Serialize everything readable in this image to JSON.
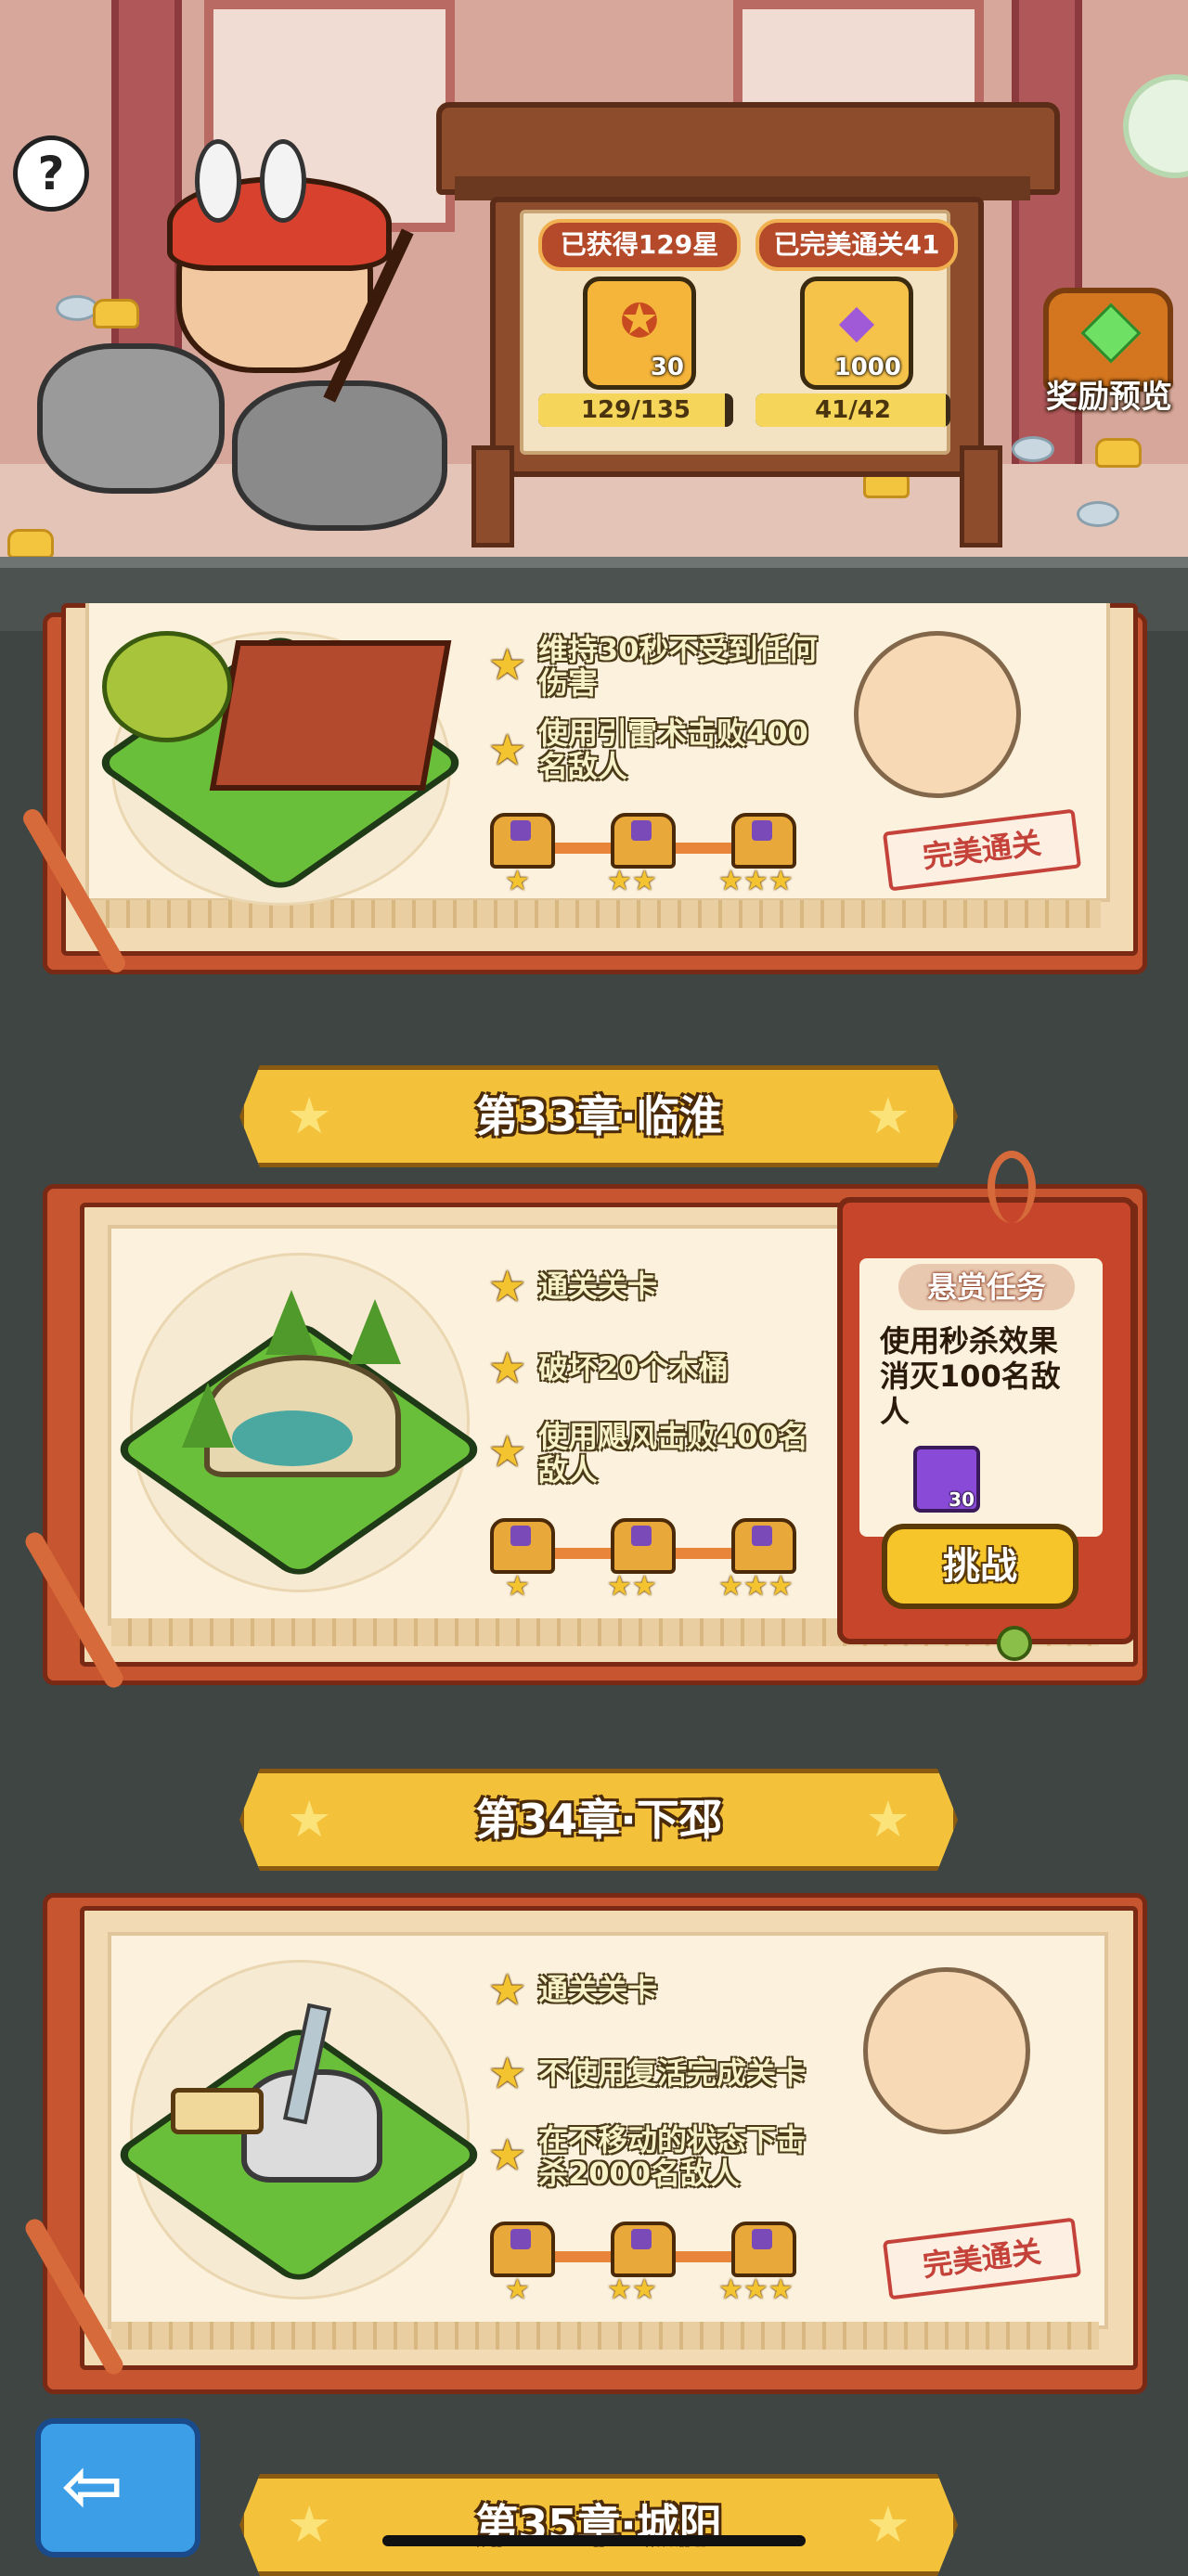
{
  "header": {
    "help_icon": "question-mark-icon",
    "stars_label": "已获得129星",
    "perfect_label": "已完美通关41",
    "stars_reward_count": "30",
    "perfect_reward_count": "1000",
    "stars_progress": "129/135",
    "stars_progress_fraction": 0.956,
    "perfect_progress": "41/42",
    "perfect_progress_fraction": 0.976,
    "reward_preview_label": "奖励预览",
    "reward_preview_icon": "treasure-chest-icon"
  },
  "chapters": [
    {
      "tasks": [
        "维持30秒不受到任何伤害",
        "使用引雷术击败400名敌人"
      ],
      "task_lines": [
        [
          "维持30秒不受到任何",
          "伤害"
        ],
        [
          "使用引雷术击败400",
          "名敌人"
        ]
      ],
      "status": "完美通关"
    },
    {
      "title": "第33章·临淮",
      "tasks": [
        "通关关卡",
        "破坏20个木桶",
        "使用飓风击败400名敌人"
      ],
      "task_lines": [
        [
          "通关关卡"
        ],
        [
          "破坏20个木桶"
        ],
        [
          "使用飓风击败400名",
          "敌人"
        ]
      ],
      "bounty": {
        "title": "悬赏任务",
        "desc_lines": [
          "使用秒杀效果",
          "消灭100名敌",
          "人"
        ],
        "reward_count": "30",
        "button": "挑战"
      }
    },
    {
      "title": "第34章·下邳",
      "tasks": [
        "通关关卡",
        "不使用复活完成关卡",
        "在不移动的状态下击杀2000名敌人"
      ],
      "task_lines": [
        [
          "通关关卡"
        ],
        [
          "不使用复活完成关卡"
        ],
        [
          "在不移动的状态下击",
          "杀2000名敌人"
        ]
      ],
      "status": "完美通关"
    },
    {
      "title": "第35章·城阳"
    }
  ],
  "back_button_icon": "back-arrow-icon",
  "colors": {
    "background": "#3e4543",
    "banner_gold": "#f4c13a",
    "card_red": "#c7552f",
    "page_cream": "#fbf1dc",
    "task_text": "#f8f2c8",
    "stamp_red": "#c4423a",
    "button_blue": "#3d9ee8"
  }
}
